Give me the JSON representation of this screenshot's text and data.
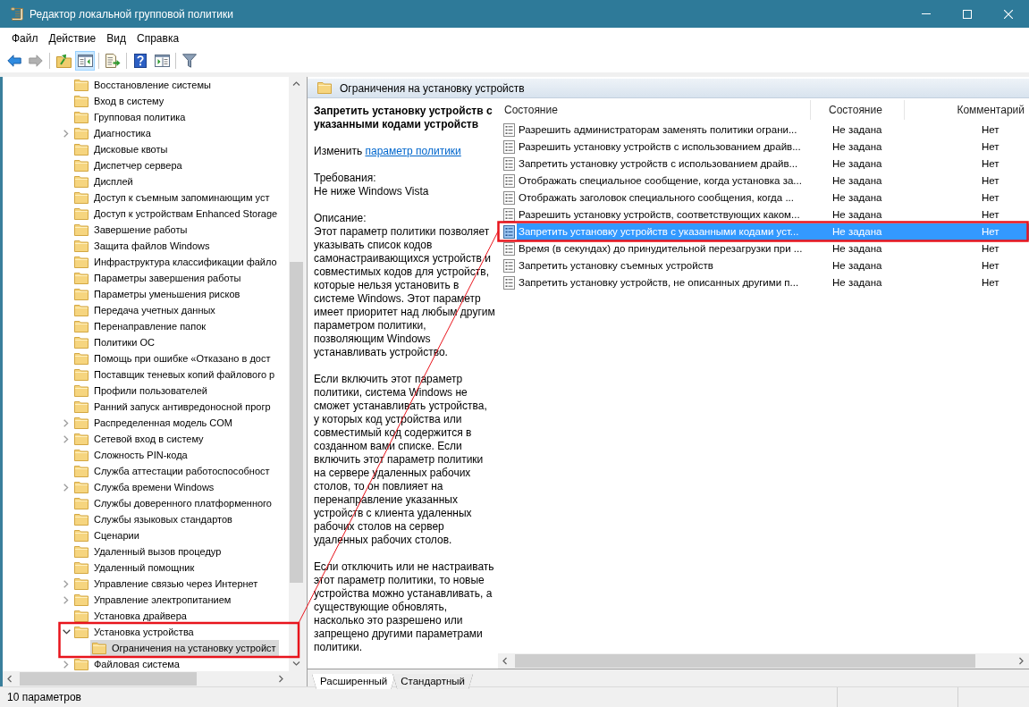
{
  "window": {
    "title": "Редактор локальной групповой политики"
  },
  "menu": [
    "Файл",
    "Действие",
    "Вид",
    "Справка"
  ],
  "toolbar_groups": [
    {
      "buttons": [
        {
          "kind": "back",
          "disabled": false,
          "on": false
        },
        {
          "kind": "forward",
          "disabled": true,
          "on": false
        }
      ]
    },
    {
      "buttons": [
        {
          "kind": "up",
          "disabled": false,
          "on": false
        },
        {
          "kind": "tree_pane",
          "disabled": false,
          "on": true
        }
      ]
    },
    {
      "buttons": [
        {
          "kind": "export",
          "disabled": false,
          "on": false
        }
      ]
    },
    {
      "buttons": [
        {
          "kind": "help",
          "disabled": false,
          "on": false
        },
        {
          "kind": "action_pane",
          "disabled": false,
          "on": false
        }
      ]
    },
    {
      "buttons": [
        {
          "kind": "filter",
          "disabled": false,
          "on": false
        }
      ]
    }
  ],
  "tree": {
    "items": [
      {
        "label": "Восстановление системы",
        "expandable": false,
        "expanded": false,
        "selected": false
      },
      {
        "label": "Вход в систему",
        "expandable": false,
        "expanded": false,
        "selected": false
      },
      {
        "label": "Групповая политика",
        "expandable": false,
        "expanded": false,
        "selected": false
      },
      {
        "label": "Диагностика",
        "expandable": true,
        "expanded": false,
        "selected": false
      },
      {
        "label": "Дисковые квоты",
        "expandable": false,
        "expanded": false,
        "selected": false
      },
      {
        "label": "Диспетчер сервера",
        "expandable": false,
        "expanded": false,
        "selected": false
      },
      {
        "label": "Дисплей",
        "expandable": false,
        "expanded": false,
        "selected": false
      },
      {
        "label": "Доступ к съемным запоминающим уст",
        "expandable": false,
        "expanded": false,
        "selected": false
      },
      {
        "label": "Доступ к устройствам Enhanced Storage",
        "expandable": false,
        "expanded": false,
        "selected": false
      },
      {
        "label": "Завершение работы",
        "expandable": false,
        "expanded": false,
        "selected": false
      },
      {
        "label": "Защита файлов Windows",
        "expandable": false,
        "expanded": false,
        "selected": false
      },
      {
        "label": "Инфраструктура классификации файло",
        "expandable": false,
        "expanded": false,
        "selected": false
      },
      {
        "label": "Параметры завершения работы",
        "expandable": false,
        "expanded": false,
        "selected": false
      },
      {
        "label": "Параметры уменьшения рисков",
        "expandable": false,
        "expanded": false,
        "selected": false
      },
      {
        "label": "Передача учетных данных",
        "expandable": false,
        "expanded": false,
        "selected": false
      },
      {
        "label": "Перенаправление папок",
        "expandable": false,
        "expanded": false,
        "selected": false
      },
      {
        "label": "Политики ОС",
        "expandable": false,
        "expanded": false,
        "selected": false
      },
      {
        "label": "Помощь при ошибке «Отказано в дост",
        "expandable": false,
        "expanded": false,
        "selected": false
      },
      {
        "label": "Поставщик теневых копий файлового р",
        "expandable": false,
        "expanded": false,
        "selected": false
      },
      {
        "label": "Профили пользователей",
        "expandable": false,
        "expanded": false,
        "selected": false
      },
      {
        "label": "Ранний запуск антивредоносной прогр",
        "expandable": false,
        "expanded": false,
        "selected": false
      },
      {
        "label": "Распределенная модель COM",
        "expandable": true,
        "expanded": false,
        "selected": false
      },
      {
        "label": "Сетевой вход в систему",
        "expandable": true,
        "expanded": false,
        "selected": false
      },
      {
        "label": "Сложность PIN-кода",
        "expandable": false,
        "expanded": false,
        "selected": false
      },
      {
        "label": "Служба аттестации работоспособност",
        "expandable": false,
        "expanded": false,
        "selected": false
      },
      {
        "label": "Служба времени Windows",
        "expandable": true,
        "expanded": false,
        "selected": false
      },
      {
        "label": "Службы доверенного платформенного",
        "expandable": false,
        "expanded": false,
        "selected": false
      },
      {
        "label": "Службы языковых стандартов",
        "expandable": false,
        "expanded": false,
        "selected": false
      },
      {
        "label": "Сценарии",
        "expandable": false,
        "expanded": false,
        "selected": false
      },
      {
        "label": "Удаленный вызов процедур",
        "expandable": false,
        "expanded": false,
        "selected": false
      },
      {
        "label": "Удаленный помощник",
        "expandable": false,
        "expanded": false,
        "selected": false
      },
      {
        "label": "Управление связью через Интернет",
        "expandable": true,
        "expanded": false,
        "selected": false
      },
      {
        "label": "Управление электропитанием",
        "expandable": true,
        "expanded": false,
        "selected": false
      },
      {
        "label": "Установка драйвера",
        "expandable": false,
        "expanded": false,
        "selected": false
      },
      {
        "label": "Установка устройства",
        "expandable": true,
        "expanded": true,
        "selected": false,
        "children": [
          {
            "label": "Ограничения на установку устройст",
            "expandable": false,
            "expanded": false,
            "selected": true
          }
        ]
      },
      {
        "label": "Файловая система",
        "expandable": true,
        "expanded": false,
        "selected": false
      }
    ]
  },
  "content": {
    "header": "Ограничения на установку устройств",
    "details": {
      "title": "Запретить установку устройств с указанными кодами устройств",
      "edit_text": "Изменить",
      "edit_link": "параметр политики",
      "requirements_label": "Требования:",
      "requirements": "Не ниже Windows Vista",
      "description_label": "Описание:",
      "paragraphs": [
        "Этот параметр политики позволяет указывать список кодов самонастраивающихся устройств и совместимых кодов для устройств, которые нельзя установить в системе Windows. Этот параметр имеет приоритет над любым другим параметром политики, позволяющим Windows устанавливать устройство.",
        "Если включить этот параметр политики, система Windows не сможет устанавливать устройства, у которых код устройства или совместимый код содержится в созданном вами списке. Если включить этот параметр политики на сервере удаленных рабочих столов, то он повлияет на перенаправление указанных устройств с клиента удаленных рабочих столов на сервер удаленных рабочих столов.",
        "Если отключить или не настраивать этот параметр политики, то новые устройства можно устанавливать, а существующие обновлять, насколько это разрешено или запрещено другими параметрами политики."
      ]
    },
    "list": {
      "columns": [
        "Состояние",
        "Состояние",
        "Комментарий"
      ],
      "rows": [
        {
          "name": "Разрешить администраторам заменять политики ограни...",
          "state": "Не задана",
          "comment": "Нет",
          "selected": false
        },
        {
          "name": "Разрешить установку устройств с использованием драйв...",
          "state": "Не задана",
          "comment": "Нет",
          "selected": false
        },
        {
          "name": "Запретить установку устройств с использованием драйв...",
          "state": "Не задана",
          "comment": "Нет",
          "selected": false
        },
        {
          "name": "Отображать специальное сообщение, когда установка за...",
          "state": "Не задана",
          "comment": "Нет",
          "selected": false
        },
        {
          "name": "Отображать заголовок специального сообщения, когда ...",
          "state": "Не задана",
          "comment": "Нет",
          "selected": false
        },
        {
          "name": "Разрешить установку устройств, соответствующих каком...",
          "state": "Не задана",
          "comment": "Нет",
          "selected": false
        },
        {
          "name": "Запретить установку устройств с указанными кодами уст...",
          "state": "Не задана",
          "comment": "Нет",
          "selected": true
        },
        {
          "name": "Время (в секундах) до принудительной перезагрузки при ...",
          "state": "Не задана",
          "comment": "Нет",
          "selected": false
        },
        {
          "name": "Запретить установку съемных устройств",
          "state": "Не задана",
          "comment": "Нет",
          "selected": false
        },
        {
          "name": "Запретить установку устройств, не описанных другими п...",
          "state": "Не задана",
          "comment": "Нет",
          "selected": false
        }
      ]
    },
    "tabs": [
      {
        "label": "Расширенный",
        "selected": true
      },
      {
        "label": "Стандартный",
        "selected": false
      }
    ]
  },
  "status_bar": {
    "text": "10 параметров"
  }
}
